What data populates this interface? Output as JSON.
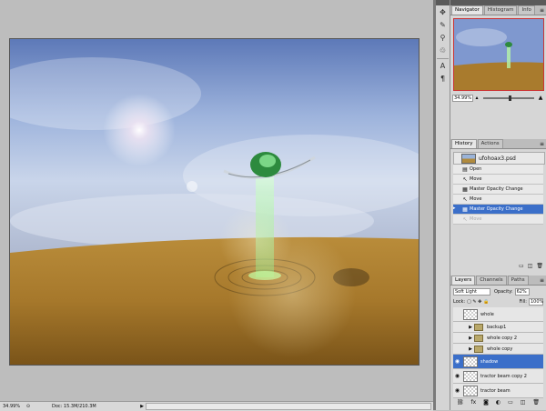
{
  "statusbar": {
    "zoom": "34.99%",
    "doc": "Doc: 15.3M/210.3M"
  },
  "navigator": {
    "tabs": [
      "Navigator",
      "Histogram",
      "Info"
    ],
    "zoom": "34.99%"
  },
  "history": {
    "tabs": [
      "History",
      "Actions"
    ],
    "snapshot": "ufohoax3.psd",
    "items": [
      {
        "label": "Open",
        "state": "normal"
      },
      {
        "label": "Move",
        "state": "normal"
      },
      {
        "label": "Master Opacity Change",
        "state": "normal"
      },
      {
        "label": "Move",
        "state": "normal"
      },
      {
        "label": "Master Opacity Change",
        "state": "selected"
      },
      {
        "label": "Move",
        "state": "dim"
      }
    ]
  },
  "layers": {
    "tabs": [
      "Layers",
      "Channels",
      "Paths"
    ],
    "blend_mode": "Soft Light",
    "opacity_label": "Opacity:",
    "opacity": "62%",
    "lock_label": "Lock:",
    "fill_label": "Fill:",
    "fill": "100%",
    "rows": [
      {
        "name": "whole",
        "type": "layer",
        "visible": false
      },
      {
        "name": "backup1",
        "type": "group",
        "visible": false
      },
      {
        "name": "whole copy 2",
        "type": "group",
        "visible": false
      },
      {
        "name": "whole copy",
        "type": "group",
        "visible": false
      },
      {
        "name": "shadow",
        "type": "layer",
        "visible": true,
        "selected": true
      },
      {
        "name": "tractor beam copy 2",
        "type": "layer",
        "visible": true
      },
      {
        "name": "tractor beam",
        "type": "layer",
        "visible": true
      }
    ]
  },
  "colors": {
    "selection": "#3b6fc9",
    "nav_frame": "#cc3333"
  },
  "icons": {
    "dock": [
      "move-tool-icon",
      "brush-icon",
      "clone-stamp-icon",
      "history-brush-icon",
      "type-tool-icon",
      "paragraph-icon"
    ]
  }
}
